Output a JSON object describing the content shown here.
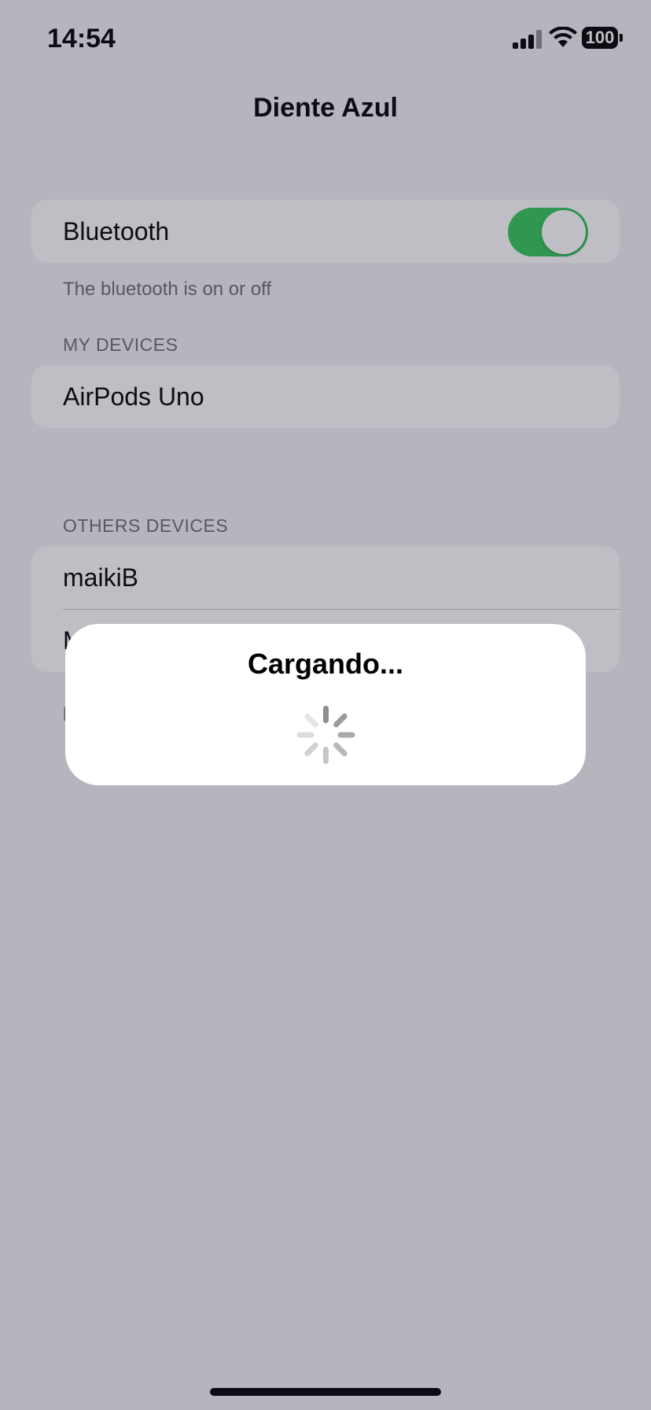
{
  "status_bar": {
    "time": "14:54",
    "battery": "100",
    "icons": [
      "signal-icon",
      "wifi-icon",
      "battery-icon"
    ]
  },
  "nav": {
    "title": "Diente Azul"
  },
  "bluetooth_section": {
    "label": "Bluetooth",
    "toggle_on": true,
    "footer": "The bluetooth is on or off"
  },
  "my_devices": {
    "header": "MY DEVICES",
    "items": [
      "AirPods Uno"
    ]
  },
  "other_devices": {
    "header": "OTHERS DEVICES",
    "items": [
      "maikiB",
      "M"
    ],
    "footer": "l"
  },
  "alert": {
    "title": "Cargando..."
  },
  "colors": {
    "toggle_on": "#34c759",
    "background": "#f2f2f7",
    "overlay": "rgba(40,40,60,0.30)"
  }
}
